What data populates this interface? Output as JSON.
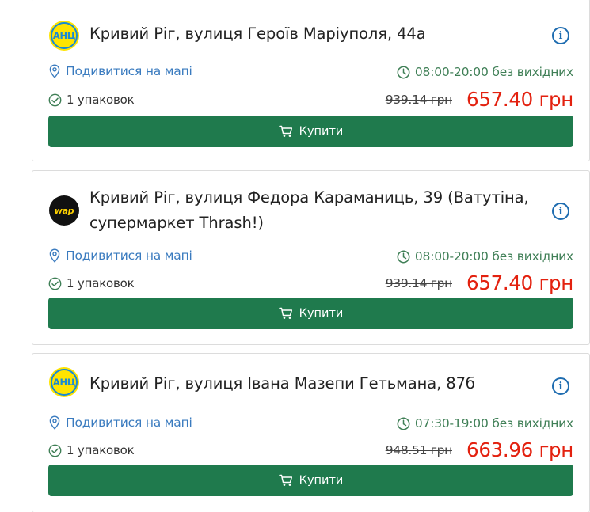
{
  "colors": {
    "accent_green": "#1f7a4d",
    "price_red": "#e3210f",
    "link_blue": "#3a7bbf",
    "hours_green": "#3f7f56"
  },
  "stores": [
    {
      "logo_text": "АНЦ",
      "logo_brand": "anc",
      "address": "Кривий Ріг, вулиця Героїв Маріуполя, 44а",
      "info_icon": "info-icon",
      "map_link": "Подивитися на мапі",
      "hours": "08:00-20:00 без вихідних",
      "packs": "1 упаковок",
      "old_price": "939.14 грн",
      "new_price": "657.40 грн",
      "buy_label": "Купити"
    },
    {
      "logo_text": "wap",
      "logo_brand": "wap",
      "address": "Кривий Ріг, вулиця Федора Караманиць, 39 (Ватутіна, супермаркет Thrash!)",
      "info_icon": "info-icon",
      "map_link": "Подивитися на мапі",
      "hours": "08:00-20:00 без вихідних",
      "packs": "1 упаковок",
      "old_price": "939.14 грн",
      "new_price": "657.40 грн",
      "buy_label": "Купити"
    },
    {
      "logo_text": "АНЦ",
      "logo_brand": "anc",
      "address": "Кривий Ріг, вулиця Івана Мазепи Гетьмана, 87б",
      "info_icon": "info-icon",
      "map_link": "Подивитися на мапі",
      "hours": "07:30-19:00 без вихідних",
      "packs": "1 упаковок",
      "old_price": "948.51 грн",
      "new_price": "663.96 грн",
      "buy_label": "Купити"
    }
  ]
}
